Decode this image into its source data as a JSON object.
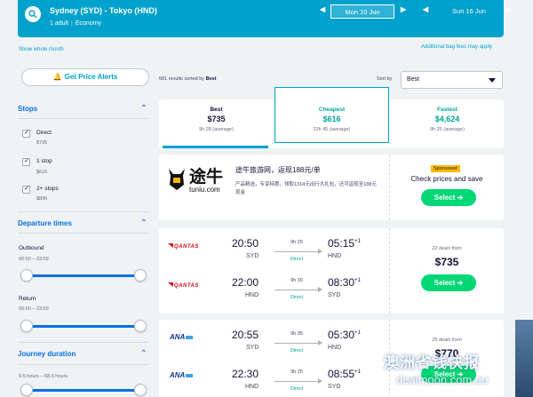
{
  "header": {
    "route": "Sydney (SYD) - Tokyo (HND)",
    "adults": "1 adult",
    "cabin": "Economy",
    "depart_date": "Mon 10 Jun",
    "return_date": "Sun 16 Jun",
    "prev_glyph": "◀",
    "next_glyph": "▶"
  },
  "links": {
    "whole_month": "Show whole month",
    "bag_fees": "Additional bag fees may apply"
  },
  "sidebar": {
    "alerts": "Get Price Alerts",
    "stops_title": "Stops",
    "stops": [
      {
        "label": "Direct",
        "price": "$735"
      },
      {
        "label": "1 stop",
        "price": "$616"
      },
      {
        "label": "2+ stops",
        "price": "$896"
      }
    ],
    "dep_title": "Departure times",
    "outbound_label": "Outbound",
    "outbound_range": "00:00 – 23:59",
    "return_label": "Return",
    "return_range": "00:00 – 23:59",
    "duration_title": "Journey duration",
    "duration_range": "9.5 hours – 68.5 hours"
  },
  "results": {
    "count_prefix": "681 results sorted by",
    "count_sort": "Best",
    "sort_label": "Sort by",
    "sort_value": "Best"
  },
  "tabs": [
    {
      "title": "Best",
      "price": "$735",
      "time": "9h 28 (average)"
    },
    {
      "title": "Cheapest",
      "price": "$616",
      "time": "22h 45 (average)"
    },
    {
      "title": "Fastest",
      "price": "$4,624",
      "time": "9h 25 (average)"
    }
  ],
  "sponsored": {
    "brand_cn": "途牛",
    "brand_en": "tuniu.com",
    "title": "途牛旅游网，返现188元/单",
    "desc": "产品精选，专享特惠，领取1314元出行大礼包，还可返现至188元现金",
    "badge": "Sponsored",
    "check": "Check prices and save",
    "select": "Select ➔"
  },
  "flights": [
    {
      "airline": "QANTAS",
      "deals": "22 deals from",
      "price": "$735",
      "select": "Select ➔",
      "legs": [
        {
          "dep": "20:50",
          "from": "SYD",
          "dur": "9h 25",
          "stop": "Direct",
          "arr": "05:15",
          "plus": "+1",
          "to": "HND"
        },
        {
          "dep": "22:00",
          "from": "HND",
          "dur": "9h 30",
          "stop": "Direct",
          "arr": "08:30",
          "plus": "+1",
          "to": "SYD"
        }
      ]
    },
    {
      "airline": "ANA",
      "deals": "25 deals from",
      "price": "$770",
      "select": "Select ➔",
      "legs": [
        {
          "dep": "20:55",
          "from": "SYD",
          "dur": "9h 35",
          "stop": "Direct",
          "arr": "05:30",
          "plus": "+1",
          "to": "HND"
        },
        {
          "dep": "22:30",
          "from": "HND",
          "dur": "9h 25",
          "stop": "Direct",
          "arr": "08:55",
          "plus": "+1",
          "to": "SYD"
        }
      ]
    }
  ],
  "watermark": {
    "line1": "澳洲省钱快报",
    "line2": "dealmoon.com.au"
  },
  "colors": {
    "header": "#00a1cc",
    "accent": "#0770e3",
    "cta": "#00d775",
    "cheapest": "#00a698"
  }
}
